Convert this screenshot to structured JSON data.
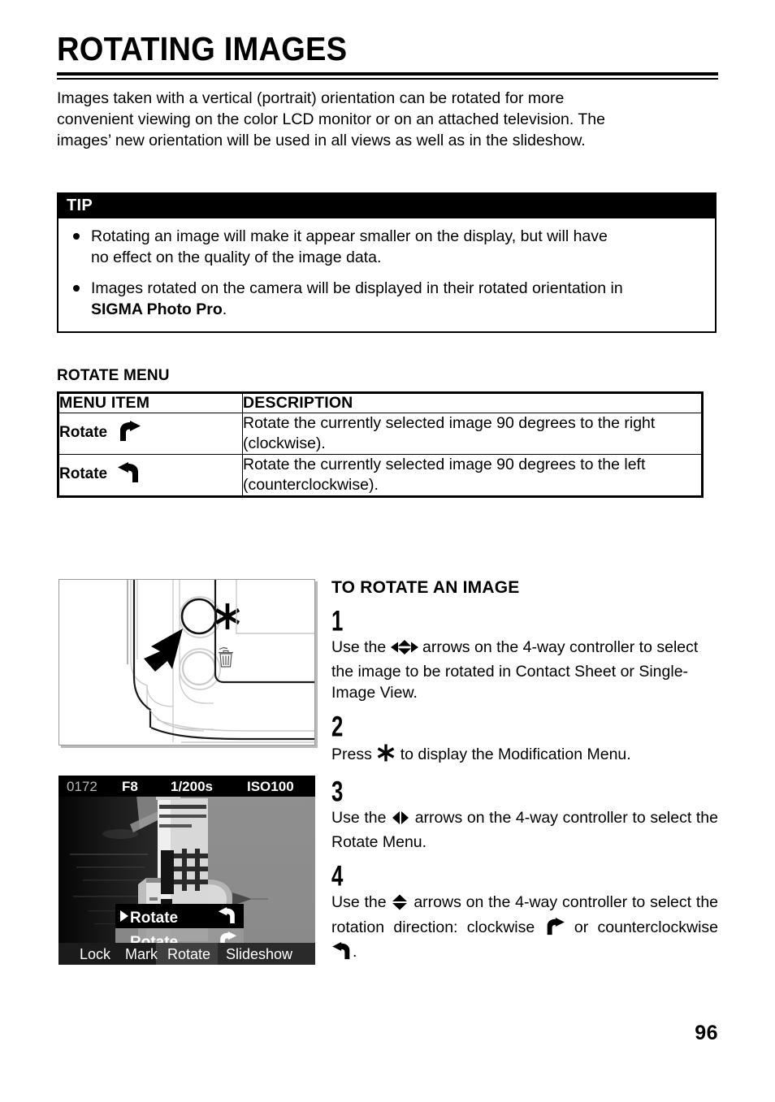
{
  "document": {
    "title": "ROTATING IMAGES",
    "page_number": "96",
    "intro": {
      "line1": "Images taken with a vertical (portrait) orientation can be rotated for more",
      "line2": "convenient viewing on the color LCD monitor or on an attached television. The",
      "line3": "images’ new orientation will be used in all views as well as in the slideshow."
    }
  },
  "tip": {
    "header": "TIP",
    "items": [
      {
        "line1": "Rotating an image will make it appear smaller on the display, but will have",
        "line2": "no effect on the quality of the image data."
      },
      {
        "line1": "Images rotated on the camera will be displayed in their rotated orientation in",
        "bold_term": "SIGMA Photo Pro",
        "line2_tail": "."
      }
    ]
  },
  "rotate_menu": {
    "heading": "ROTATE MENU",
    "columns": [
      "MENU ITEM",
      "DESCRIPTION"
    ],
    "rows": [
      {
        "item": "Rotate",
        "item_icon": "rotate-clockwise-icon",
        "desc_line1": "Rotate the currently selected image 90 degrees to the right",
        "desc_line2": "(clockwise)."
      },
      {
        "item": "Rotate",
        "item_icon": "rotate-counterclockwise-icon",
        "desc_line1": "Rotate the currently selected image 90 degrees to the left",
        "desc_line2": "(counterclockwise)."
      }
    ]
  },
  "instructions": {
    "title": "TO ROTATE AN IMAGE",
    "steps": [
      {
        "number": "1",
        "pre": "Use the",
        "icon": "four-way-arrows-icon",
        "post_line1": "arrows on the 4-way controller to",
        "post_line2": "select the image to be rotated in Contact Sheet",
        "post_line3": "or Single-Image View."
      },
      {
        "number": "2",
        "pre": "Press",
        "icon": "asterisk-button-icon",
        "post_line1": "to display the Modification Menu."
      },
      {
        "number": "3",
        "pre": "Use the",
        "icon": "left-right-arrows-icon",
        "post_line1": "arrows on the 4-way controller to",
        "post_line2": "select the Rotate Menu."
      },
      {
        "number": "4",
        "pre": "Use the",
        "icon": "up-down-arrows-icon",
        "post_line1": "arrows on the 4-way controller to",
        "post_line2_a": "select the rotation direction: clockwise",
        "post_icon_a": "rotate-clockwise-icon",
        "post_line2_b": "or",
        "post_line3_a": "counterclockwise",
        "post_icon_b": "rotate-counterclockwise-icon",
        "post_line3_b": "."
      }
    ]
  },
  "camera_figure": {
    "alt": "camera back showing asterisk button and trash button with pointer arrow",
    "asterisk_label": "✳",
    "trash_label": "trash-icon"
  },
  "lcd_figure": {
    "info_bar": {
      "frame_number": "0172",
      "aperture": "F8",
      "shutter": "1/200s",
      "iso": "ISO100"
    },
    "overlay_menu": {
      "selected_marker": "▶",
      "items": [
        {
          "label": "Rotate",
          "icon": "rotate-counterclockwise-icon",
          "selected": true
        },
        {
          "label": "Rotate",
          "icon": "rotate-clockwise-icon",
          "selected": false
        }
      ]
    },
    "bottom_tabs": [
      {
        "label": "Lock",
        "active": false
      },
      {
        "label": "Mark",
        "active": false
      },
      {
        "label": "Rotate",
        "active": true
      },
      {
        "label": "Slideshow",
        "active": false
      }
    ]
  },
  "colors": {
    "ink": "#000000",
    "paper": "#ffffff",
    "figure_border": "#9a9a9a",
    "figure_shadow": "#b9b9b9",
    "lcd_sky": "#8c8c8c",
    "lcd_dark": "#1a1a1a"
  }
}
